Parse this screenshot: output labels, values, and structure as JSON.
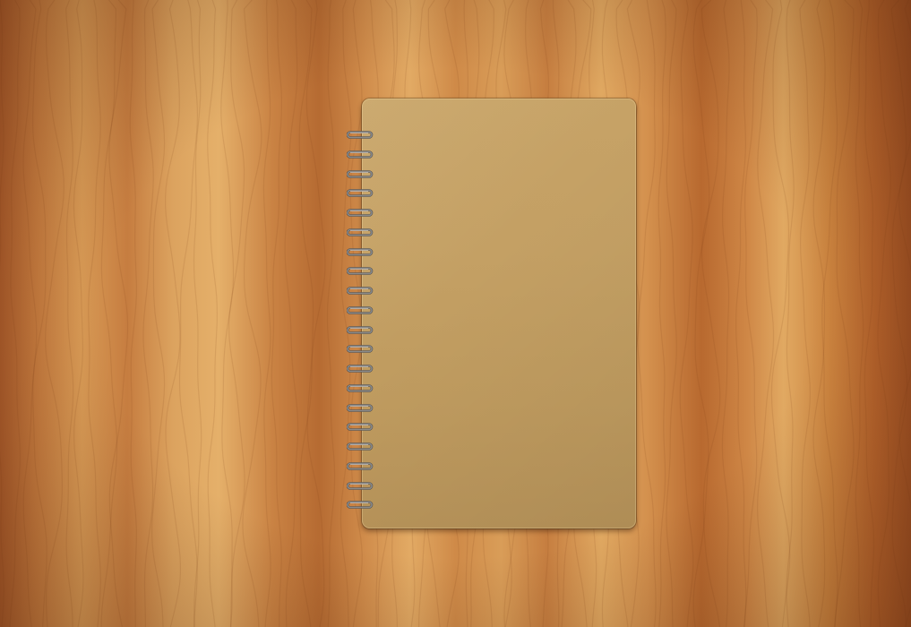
{
  "scene": {
    "background": "wood-grain-desk",
    "object": "spiral-notebook",
    "cover_color": "#c4a064",
    "wood_color": "#c98243",
    "ring_color": "#8a8a8a"
  },
  "rings": {
    "count": 20
  }
}
